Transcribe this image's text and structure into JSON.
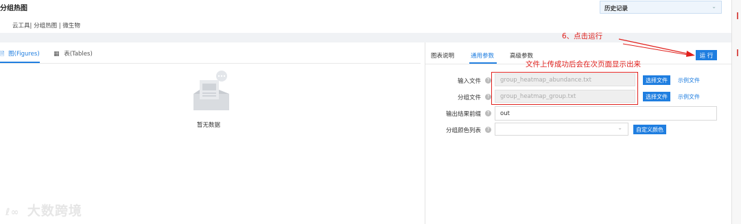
{
  "page": {
    "title": "分组热图",
    "breadcrumb": "云工具| 分组热图 | 微生物"
  },
  "history": {
    "label": "历史记录"
  },
  "left_tabs": [
    {
      "label": "图(Figures)"
    },
    {
      "label": "表(Tables)"
    }
  ],
  "empty": {
    "text": "暂无数据"
  },
  "right_tabs": [
    {
      "label": "图表说明"
    },
    {
      "label": "通用参数"
    },
    {
      "label": "高级参数"
    }
  ],
  "run_button": "运 行",
  "annotations": {
    "run": "6、点击运行",
    "upload": "文件上传成功后会在次页面显示出来"
  },
  "form": {
    "input_file": {
      "label": "输入文件",
      "value": "group_heatmap_abundance.txt",
      "button": "选择文件",
      "example": "示例文件"
    },
    "group_file": {
      "label": "分组文件",
      "value": "group_heatmap_group.txt",
      "button": "选择文件",
      "example": "示例文件"
    },
    "prefix": {
      "label": "输出结果前缀",
      "value": "out"
    },
    "colors": {
      "label": "分组颜色列表",
      "button": "自定义颜色"
    }
  },
  "watermark": "大数跨境",
  "colors": {
    "accent": "#1f7ee0",
    "annotation": "#e0201c"
  }
}
